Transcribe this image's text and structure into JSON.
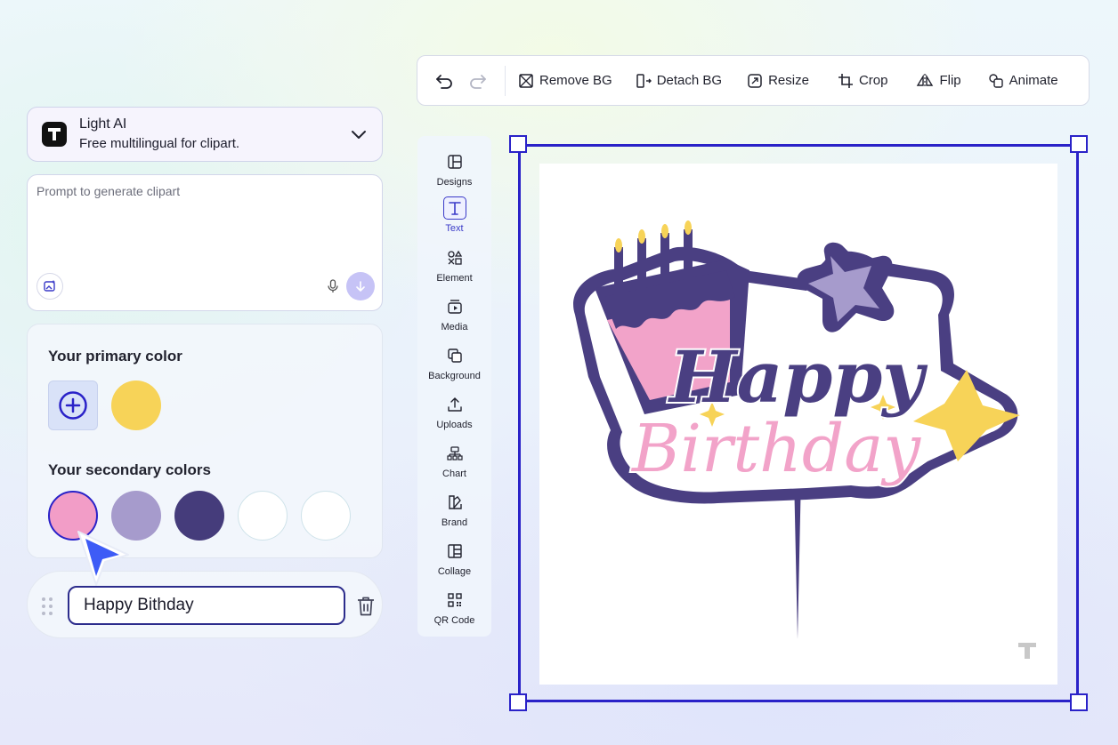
{
  "model": {
    "name": "Light AI",
    "description": "Free multilingual for clipart.",
    "logo_icon": "T-logo-icon"
  },
  "prompt": {
    "placeholder": "Prompt to generate clipart",
    "value": ""
  },
  "colors": {
    "primary_title": "Your primary color",
    "primary": [
      "#f7d358"
    ],
    "secondary_title": "Your secondary colors",
    "secondary": [
      "#f29dc7",
      "#a69bcc",
      "#453c7b",
      "#ffffff",
      "#ffffff"
    ],
    "selected_secondary_index": 0
  },
  "text_layer": {
    "value": "Happy Bithday"
  },
  "toolbar": {
    "undo_icon": "undo-icon",
    "redo_icon": "redo-icon",
    "remove_bg": "Remove BG",
    "detach_bg": "Detach BG",
    "resize": "Resize",
    "crop": "Crop",
    "flip": "Flip",
    "animate": "Animate"
  },
  "sidenav": {
    "items": [
      {
        "label": "Designs",
        "icon": "layout-icon"
      },
      {
        "label": "Text",
        "icon": "text-icon",
        "active": true
      },
      {
        "label": "Element",
        "icon": "shapes-icon"
      },
      {
        "label": "Media",
        "icon": "media-icon"
      },
      {
        "label": "Background",
        "icon": "background-icon"
      },
      {
        "label": "Uploads",
        "icon": "upload-icon"
      },
      {
        "label": "Chart",
        "icon": "chart-icon"
      },
      {
        "label": "Brand",
        "icon": "brand-icon"
      },
      {
        "label": "Collage",
        "icon": "collage-icon"
      },
      {
        "label": "QR Code",
        "icon": "qr-code-icon"
      }
    ]
  },
  "artwork": {
    "line1": "Happy",
    "line2": "Birthday",
    "colors": {
      "outline": "#4a3f82",
      "pink": "#f2a3c9",
      "yellow": "#f7d358",
      "lavender": "#a69bcc"
    }
  },
  "theme": {
    "accent": "#2a22c8"
  }
}
